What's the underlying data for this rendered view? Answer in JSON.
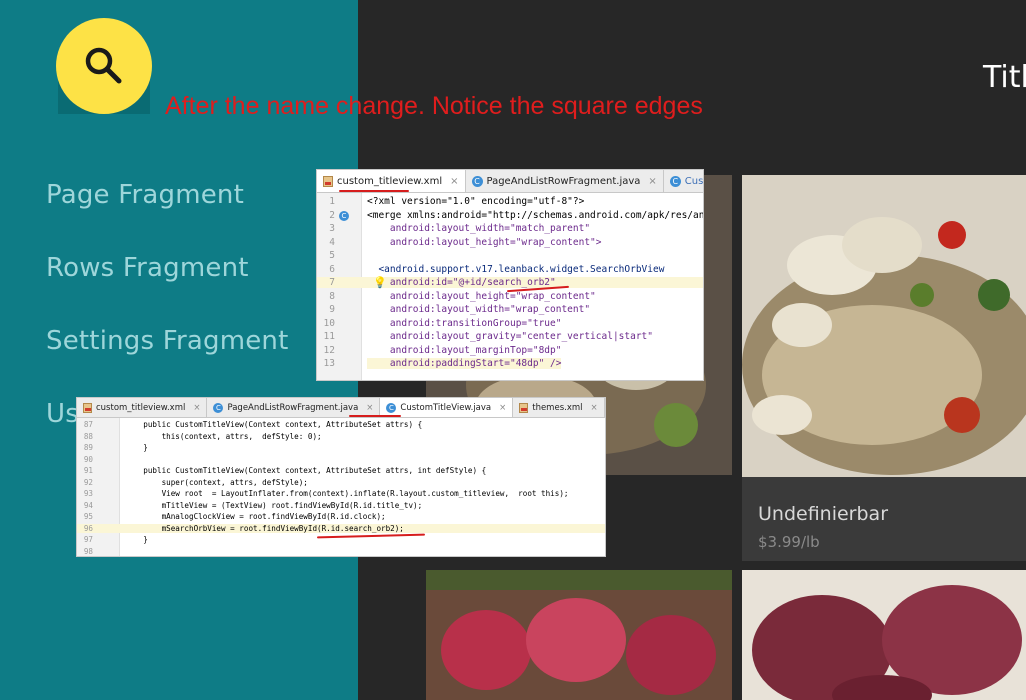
{
  "sidebar": {
    "items": [
      {
        "label": "Page Fragment"
      },
      {
        "label": "Rows Fragment"
      },
      {
        "label": "Settings Fragment"
      },
      {
        "label": "Us"
      }
    ]
  },
  "header": {
    "title": "Titl"
  },
  "annotation": "After the name change. Notice the square edges",
  "cards": [
    {
      "title": "Undefinierbar",
      "price": "$3.99/lb"
    }
  ],
  "xml_panel": {
    "tabs": [
      {
        "label": "custom_titleview.xml",
        "icon": "xml-file-icon",
        "active": true
      },
      {
        "label": "PageAndListRowFragment.java",
        "icon": "class-file-icon",
        "active": false
      },
      {
        "label": "CustomTitleVie",
        "icon": "class-file-icon",
        "active": false
      }
    ],
    "lines": [
      {
        "n": "1",
        "text": "<?xml version=\"1.0\" encoding=\"utf-8\"?>"
      },
      {
        "n": "2",
        "text": "<merge xmlns:android=\"http://schemas.android.com/apk/res/and"
      },
      {
        "n": "3",
        "text": "    android:layout_width=\"match_parent\""
      },
      {
        "n": "4",
        "text": "    android:layout_height=\"wrap_content\">"
      },
      {
        "n": "5",
        "text": ""
      },
      {
        "n": "6",
        "text": "  <android.support.v17.leanback.widget.SearchOrbView"
      },
      {
        "n": "7",
        "text": "    android:id=\"@+id/search_orb2\""
      },
      {
        "n": "8",
        "text": "    android:layout_height=\"wrap_content\""
      },
      {
        "n": "9",
        "text": "    android:layout_width=\"wrap_content\""
      },
      {
        "n": "10",
        "text": "    android:transitionGroup=\"true\""
      },
      {
        "n": "11",
        "text": "    android:layout_gravity=\"center_vertical|start\""
      },
      {
        "n": "12",
        "text": "    android:layout_marginTop=\"8dp\""
      },
      {
        "n": "13",
        "text": "    android:paddingStart=\"48dp\" />"
      }
    ]
  },
  "java_panel": {
    "tabs": [
      {
        "label": "custom_titleview.xml",
        "icon": "xml-file-icon",
        "active": false
      },
      {
        "label": "PageAndListRowFragment.java",
        "icon": "class-file-icon",
        "active": false
      },
      {
        "label": "CustomTitleView.java",
        "icon": "class-file-icon",
        "active": true
      },
      {
        "label": "themes.xml",
        "icon": "xml-file-icon",
        "active": false
      }
    ],
    "lines": [
      {
        "n": "87",
        "text": "    public CustomTitleView(Context context, AttributeSet attrs) {"
      },
      {
        "n": "88",
        "text": "        this(context, attrs,  defStyle: 0);"
      },
      {
        "n": "89",
        "text": "    }"
      },
      {
        "n": "90",
        "text": ""
      },
      {
        "n": "91",
        "text": "    public CustomTitleView(Context context, AttributeSet attrs, int defStyle) {"
      },
      {
        "n": "92",
        "text": "        super(context, attrs, defStyle);"
      },
      {
        "n": "93",
        "text": "        View root  = LayoutInflater.from(context).inflate(R.layout.custom_titleview,  root this);"
      },
      {
        "n": "94",
        "text": "        mTitleView = (TextView) root.findViewById(R.id.title_tv);"
      },
      {
        "n": "95",
        "text": "        mAnalogClockView = root.findViewById(R.id.clock);"
      },
      {
        "n": "96",
        "text": "        mSearchOrbView = root.findViewById(R.id.search_orb2);"
      },
      {
        "n": "97",
        "text": "    }"
      },
      {
        "n": "98",
        "text": ""
      }
    ]
  },
  "colors": {
    "sidebar": "#0e7c86",
    "orb": "#fde246",
    "annotation": "#e01d1d"
  }
}
